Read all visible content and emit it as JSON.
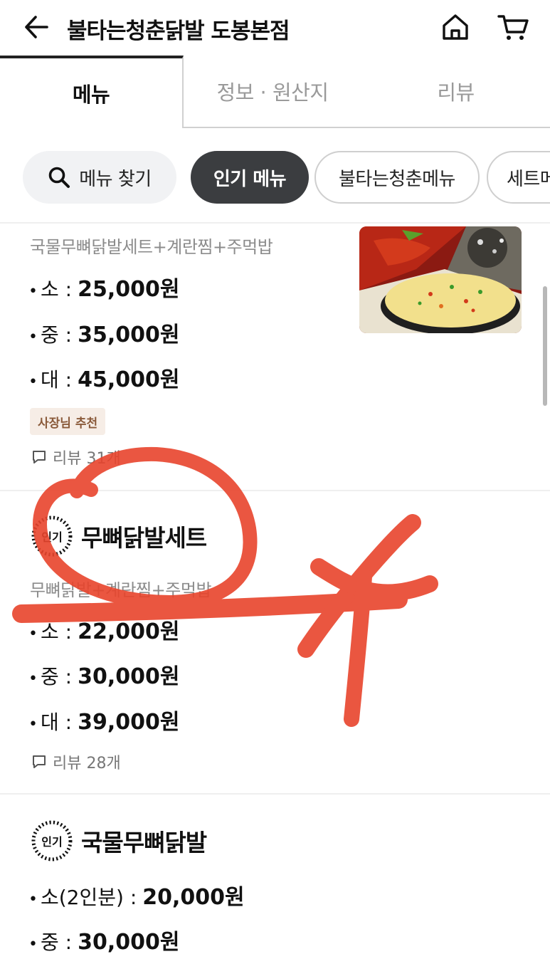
{
  "header": {
    "title": "불타는청춘닭발 도봉본점",
    "back_icon": "back-arrow-icon",
    "home_icon": "home-icon",
    "cart_icon": "cart-icon"
  },
  "tabs": [
    {
      "label": "메뉴",
      "active": true
    },
    {
      "label": "정보 · 원산지",
      "active": false
    },
    {
      "label": "리뷰",
      "active": false
    }
  ],
  "chips": {
    "search_label": "메뉴 찾기",
    "items": [
      {
        "label": "인기 메뉴",
        "active": true
      },
      {
        "label": "불타는청춘메뉴",
        "active": false
      },
      {
        "label": "세트메",
        "active": false
      }
    ]
  },
  "menu_items": [
    {
      "description": "국물무뼈닭발세트+계란찜+주먹밥",
      "prices": [
        {
          "size": "소 :",
          "price": "25,000원"
        },
        {
          "size": "중 :",
          "price": "35,000원"
        },
        {
          "size": "대 :",
          "price": "45,000원"
        }
      ],
      "badge": "사장님 추천",
      "review": "리뷰 31개"
    },
    {
      "popular_label": "인기",
      "name": "무뼈닭발세트",
      "description": "무뼈닭발+계란찜+주먹밥",
      "prices": [
        {
          "size": "소 :",
          "price": "22,000원"
        },
        {
          "size": "중 :",
          "price": "30,000원"
        },
        {
          "size": "대 :",
          "price": "39,000원"
        }
      ],
      "review": "리뷰 28개"
    },
    {
      "popular_label": "인기",
      "name": "국물무뼈닭발",
      "prices": [
        {
          "size": "소(2인분) :",
          "price": "20,000원"
        },
        {
          "size": "중 :",
          "price": "30,000원"
        }
      ]
    }
  ],
  "colors": {
    "active_chip_bg": "#3b3d40",
    "badge_bg": "#f6ede6",
    "badge_text": "#8a5a3a",
    "annotation_red": "#e8442c"
  }
}
